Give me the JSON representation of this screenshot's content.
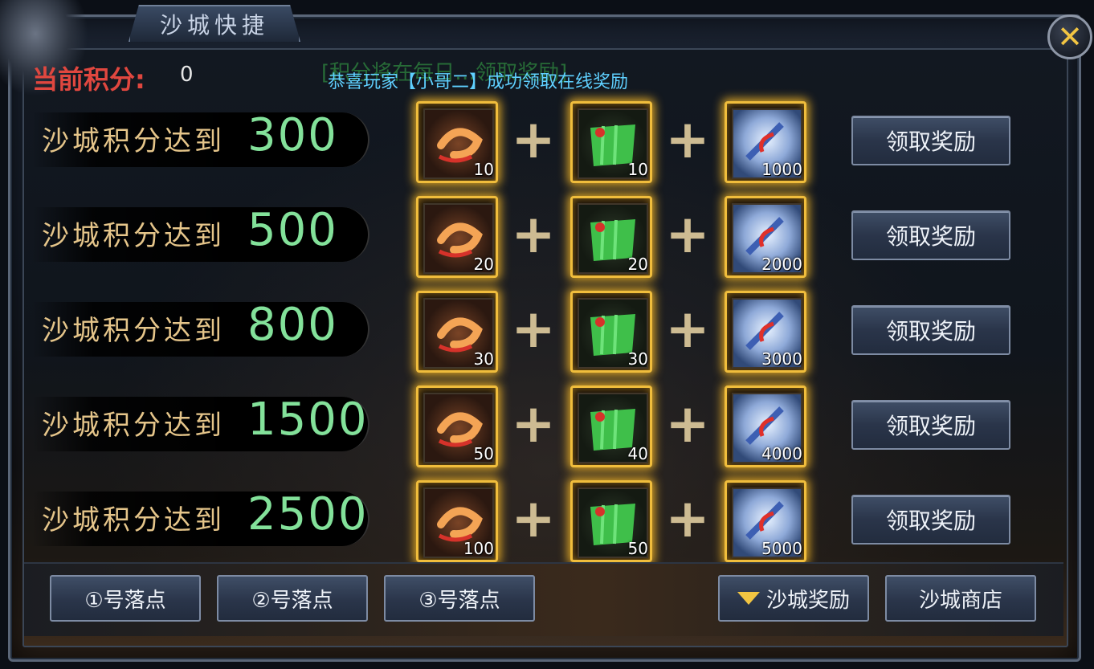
{
  "window": {
    "title": "沙城快捷",
    "close_label": "✕"
  },
  "score": {
    "label": "当前积分:",
    "value": "0"
  },
  "notices": {
    "background_text": "[积分将在每日…领取奖励]",
    "message": "恭喜玩家【小哥二】成功领取在线奖励"
  },
  "rows": [
    {
      "label": "沙城积分达到",
      "threshold": "300",
      "items": [
        "10",
        "10",
        "1000"
      ],
      "button": "领取奖励"
    },
    {
      "label": "沙城积分达到",
      "threshold": "500",
      "items": [
        "20",
        "20",
        "2000"
      ],
      "button": "领取奖励"
    },
    {
      "label": "沙城积分达到",
      "threshold": "800",
      "items": [
        "30",
        "30",
        "3000"
      ],
      "button": "领取奖励"
    },
    {
      "label": "沙城积分达到",
      "threshold": "1500",
      "items": [
        "50",
        "40",
        "4000"
      ],
      "button": "领取奖励"
    },
    {
      "label": "沙城积分达到",
      "threshold": "2500",
      "items": [
        "100",
        "50",
        "5000"
      ],
      "button": "领取奖励"
    }
  ],
  "item_icons": [
    "shrimp-icon",
    "leaf-bundle-icon",
    "crystal-icon"
  ],
  "bottom_buttons": {
    "point1": "①号落点",
    "point2": "②号落点",
    "point3": "③号落点",
    "reward": "沙城奖励",
    "shop": "沙城商店"
  },
  "colors": {
    "score_label": "#e0473f",
    "threshold_value": "#83e19a",
    "notice": "#5fd0ff",
    "item_border": "#f0bd3c",
    "close": "#f2c542"
  }
}
